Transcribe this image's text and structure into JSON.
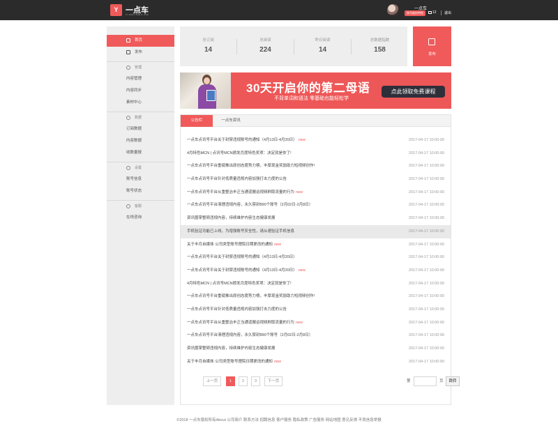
{
  "header": {
    "logo_mark": "Y",
    "brand": "一点车",
    "brand_sub": "YI DIAN CHE & CAR",
    "user_name": "一点车",
    "user_badge": "账号级别特权",
    "messages": "12",
    "logout": "退出"
  },
  "sidebar": {
    "home": "首页",
    "publish": "发布",
    "groups": [
      {
        "title": "管理",
        "items": [
          "内容管理",
          "内容同步",
          "素材中心"
        ]
      },
      {
        "title": "数据",
        "items": [
          "订阅数据",
          "内容数据",
          "收数量报"
        ]
      },
      {
        "title": "设置",
        "items": [
          "账号信息",
          "账号状态"
        ]
      },
      {
        "title": "客服",
        "items": [
          "在线咨询"
        ]
      }
    ]
  },
  "stats": [
    {
      "label": "总订阅",
      "value": "14"
    },
    {
      "label": "总阅读",
      "value": "224"
    },
    {
      "label": "昨日阅读",
      "value": "14"
    },
    {
      "label": "总数据指数",
      "value": "158"
    }
  ],
  "publish_label": "发布",
  "banner": {
    "title": "30天开启你的第二母语",
    "subtitle": "不背单词和语法 零基础也能轻松学",
    "cta": "点此领取免费课程"
  },
  "tabs": [
    "公告栏",
    "一点车资讯"
  ],
  "notices": [
    {
      "title": "一点车点讯号平台关于封禁违规账号的通知（4月13日-4月20日）",
      "new": "new",
      "date": "2017-04-17 10:00:00"
    },
    {
      "title": "4月特色MCN | 点讯号MCN颁发月度特色奖项：决定就是你了!",
      "new": "",
      "date": "2017-04-17 10:00:00"
    },
    {
      "title": "一点车点讯号平台重磅推出原创态度势力榜，丰厚现金奖励助力短视频创作!",
      "new": "",
      "date": "2017-04-17 10:00:00"
    },
    {
      "title": "一点车点讯号平台针对低质量违规内容加强打击力度的公告",
      "new": "",
      "date": "2017-04-17 10:00:00"
    },
    {
      "title": "一点车点讯号平台从重整治丰正当通道搬运视频刷取流量的行为",
      "new": "new",
      "date": "2017-04-17 10:00:00"
    },
    {
      "title": "一点车点讯号平台清理违规内容，永久禁封890个账号（2月02日-2月8日）",
      "new": "",
      "date": "2017-04-17 10:00:00"
    },
    {
      "title": "资讯圈掌整顿违规内容，持续维护内容生态健康发展",
      "new": "",
      "date": "2017-04-17 10:00:00"
    },
    {
      "title": "手机验证功能已上线，为增强账号安全性，请从速验证手机信息",
      "new": "",
      "date": "2017-04-17 10:00:00",
      "hl": true
    },
    {
      "title": "关于丰月自媒体·公司类型账号理院日期更改的通知",
      "new": "new",
      "date": "2017-04-17 10:00:00"
    },
    {
      "title": "一点车点讯号平台关于封禁违规账号的通知（4月13日-4月20日）",
      "new": "",
      "date": "2017-04-17 10:00:00"
    },
    {
      "title": "一点车点讯号平台关于封禁违规账号的通知（4月13日-4月20日）",
      "new": "new",
      "date": "2017-04-17 10:00:00"
    },
    {
      "title": "4月特色MCN | 点讯号MCN颁发月度特色奖项：决定就是你了!",
      "new": "",
      "date": "2017-04-17 10:00:00"
    },
    {
      "title": "一点车点讯号平台重磅推出原创态度势力榜，丰厚现金奖励助力短视频创作!",
      "new": "",
      "date": "2017-04-17 10:00:00"
    },
    {
      "title": "一点车点讯号平台针对低质量违规内容加强打击力度的公告",
      "new": "",
      "date": "2017-04-17 10:00:00"
    },
    {
      "title": "一点车点讯号平台从重整治丰正当通道搬运视频刷取流量的行为",
      "new": "new",
      "date": "2017-04-17 10:00:00"
    },
    {
      "title": "一点车点讯号平台清理违规内容，永久禁封890个账号（2月02日-2月8日）",
      "new": "",
      "date": "2017-04-17 10:00:00"
    },
    {
      "title": "资讯圈掌整顿违规内容，持续维护内容生态健康发展",
      "new": "",
      "date": "2017-04-17 10:00:00"
    },
    {
      "title": "关于丰月自媒体·公司类型账号理院日期更改的通知",
      "new": "new",
      "date": "2017-04-17 10:00:00"
    }
  ],
  "pagination": {
    "prev": "上一页",
    "pages": [
      "1",
      "2",
      "3"
    ],
    "current": "1",
    "next": "下一页",
    "jump_prefix": "第",
    "jump_suffix": "页",
    "jump_button": "跳转"
  },
  "footer": "©2018 一点车版权所有About 公司简介 联系方法 招聘信息 客户服务 隐私政策 广告服务 网站地图 意见反馈 不良信息举报",
  "colors": {
    "accent": "#f05a5a",
    "topbar": "#2b2b2b",
    "panel": "#eeeeee"
  }
}
